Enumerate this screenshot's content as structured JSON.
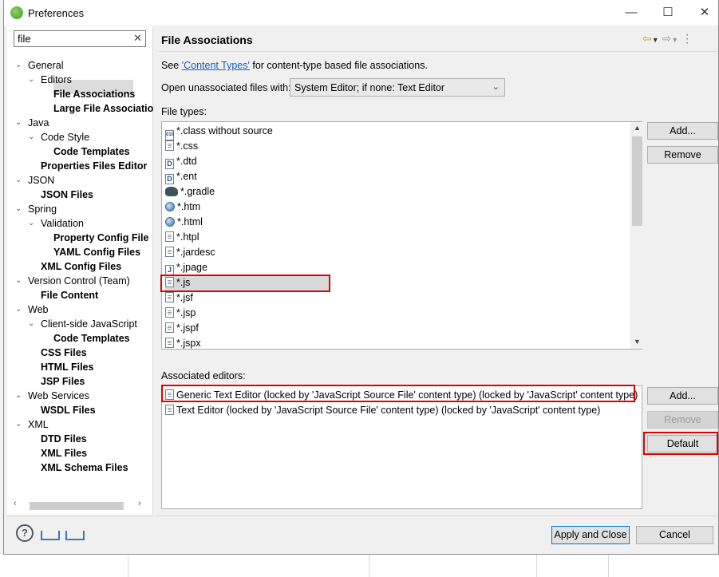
{
  "window": {
    "title": "Preferences",
    "minimize_glyph": "—",
    "maximize_glyph": "☐",
    "close_glyph": "✕"
  },
  "filter": {
    "value": "file",
    "clear_glyph": "✕"
  },
  "tree": [
    {
      "label": "General",
      "bold": false,
      "expanded": true
    },
    {
      "label": "Editors",
      "bold": false,
      "expanded": true
    },
    {
      "label": "File Associations",
      "bold": true,
      "selected": true
    },
    {
      "label": "Large File Associatio",
      "bold": true
    },
    {
      "label": "Java",
      "bold": false,
      "expanded": true
    },
    {
      "label": "Code Style",
      "bold": false,
      "expanded": true
    },
    {
      "label": "Code Templates",
      "bold": true
    },
    {
      "label": "Properties Files Editor",
      "bold": true
    },
    {
      "label": "JSON",
      "bold": false,
      "expanded": true
    },
    {
      "label": "JSON Files",
      "bold": true
    },
    {
      "label": "Spring",
      "bold": false,
      "expanded": true
    },
    {
      "label": "Validation",
      "bold": false,
      "expanded": true
    },
    {
      "label": "Property Config File",
      "bold": true
    },
    {
      "label": "YAML Config Files",
      "bold": true
    },
    {
      "label": "XML Config Files",
      "bold": true
    },
    {
      "label": "Version Control (Team)",
      "bold": false,
      "expanded": true
    },
    {
      "label": "File Content",
      "bold": true
    },
    {
      "label": "Web",
      "bold": false,
      "expanded": true
    },
    {
      "label": "Client-side JavaScript",
      "bold": false,
      "expanded": true
    },
    {
      "label": "Code Templates",
      "bold": true
    },
    {
      "label": "CSS Files",
      "bold": true
    },
    {
      "label": "HTML Files",
      "bold": true
    },
    {
      "label": "JSP Files",
      "bold": true
    },
    {
      "label": "Web Services",
      "bold": false,
      "expanded": true
    },
    {
      "label": "WSDL Files",
      "bold": true
    },
    {
      "label": "XML",
      "bold": false,
      "expanded": true
    },
    {
      "label": "DTD Files",
      "bold": true
    },
    {
      "label": "XML Files",
      "bold": true
    },
    {
      "label": "XML Schema Files",
      "bold": true
    }
  ],
  "page": {
    "title": "File Associations",
    "see_prefix": "See ",
    "see_link": "'Content Types'",
    "see_suffix": " for content-type based file associations.",
    "open_unassociated_label": "Open unassociated files with:",
    "open_unassociated_value": "System Editor; if none: Text Editor",
    "file_types_label": "File types:",
    "file_types": [
      {
        "label": "*.class without source",
        "icon": "binary-file-icon"
      },
      {
        "label": "*.css",
        "icon": "text-file-icon"
      },
      {
        "label": "*.dtd",
        "icon": "dtd-file-icon"
      },
      {
        "label": "*.ent",
        "icon": "dtd-file-icon"
      },
      {
        "label": "*.gradle",
        "icon": "gradle-icon"
      },
      {
        "label": "*.htm",
        "icon": "globe-icon"
      },
      {
        "label": "*.html",
        "icon": "globe-icon"
      },
      {
        "label": "*.htpl",
        "icon": "text-file-icon"
      },
      {
        "label": "*.jardesc",
        "icon": "jar-file-icon"
      },
      {
        "label": "*.jpage",
        "icon": "java-file-icon"
      },
      {
        "label": "*.js",
        "icon": "text-file-icon",
        "selected": true
      },
      {
        "label": "*.jsf",
        "icon": "text-file-icon"
      },
      {
        "label": "*.jsp",
        "icon": "text-file-icon"
      },
      {
        "label": "*.jspf",
        "icon": "text-file-icon"
      },
      {
        "label": "*.jspx",
        "icon": "text-file-icon"
      }
    ],
    "file_types_add": "Add...",
    "file_types_remove": "Remove",
    "associated_editors_label": "Associated editors:",
    "associated_editors": [
      {
        "label": "Generic Text Editor (locked by 'JavaScript Source File' content type) (locked by 'JavaScript' content type)",
        "icon": "text-editor-icon"
      },
      {
        "label": "Text Editor (locked by 'JavaScript Source File' content type) (locked by 'JavaScript' content type)",
        "icon": "text-file-icon"
      }
    ],
    "editors_add": "Add...",
    "editors_remove": "Remove",
    "editors_default": "Default"
  },
  "footer": {
    "apply_close": "Apply and Close",
    "cancel": "Cancel"
  },
  "colors": {
    "highlight": "#e00000",
    "link": "#1a5bc4",
    "primary_border": "#0078d7"
  }
}
